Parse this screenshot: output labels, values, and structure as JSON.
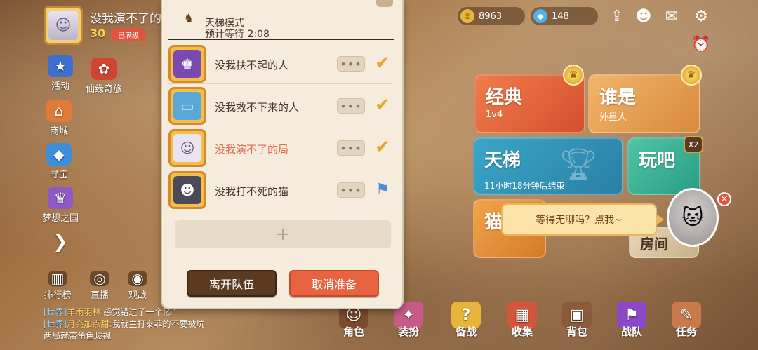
{
  "player": {
    "name": "没我演不了的局",
    "level": "30",
    "status": "已满级"
  },
  "left_nav": [
    {
      "label": "活动",
      "icon": "activity-icon"
    },
    {
      "label": "仙缘奇旅",
      "icon": "journey-icon"
    },
    {
      "label": "商城",
      "icon": "shop-icon"
    },
    {
      "label": "寻宝",
      "icon": "treasure-icon"
    },
    {
      "label": "梦想之国",
      "icon": "dreamland-icon"
    },
    {
      "label": "排行榜",
      "icon": "ranking-icon"
    },
    {
      "label": "直播",
      "icon": "live-icon"
    },
    {
      "label": "观战",
      "icon": "spectate-icon"
    }
  ],
  "resources": {
    "gold": "8963",
    "diamond": "148"
  },
  "modes": {
    "classic": {
      "title": "经典",
      "sub": "1v4"
    },
    "alien": {
      "title": "谁是",
      "sub": "外星人"
    },
    "ladder": {
      "title": "天梯",
      "sub": "11小时18分钟后结束"
    },
    "play": {
      "title": "玩吧",
      "badge": "X2"
    },
    "cat": {
      "title": "猫鼠"
    },
    "room": {
      "title": "房间"
    }
  },
  "chat_bubble": "等得无聊吗？点我~",
  "bottom_nav": [
    "角色",
    "装扮",
    "备战",
    "收集",
    "背包",
    "战队",
    "任务"
  ],
  "chat_log": [
    {
      "tag": "[世界]",
      "who": "羊雨羽林:",
      "msg": "感觉错过了一个亿？"
    },
    {
      "tag": "[世界]",
      "who": "月亮加点甜:",
      "msg": "我就主打泰菲的不要被坑两局就带角色歧视"
    }
  ],
  "team_panel": {
    "mode": "天梯模式",
    "wait": "预计等待 2:08",
    "members": [
      {
        "name": "没我扶不起的人",
        "status": "ready",
        "me": false
      },
      {
        "name": "没我救不下来的人",
        "status": "ready",
        "me": false
      },
      {
        "name": "没我演不了的局",
        "status": "ready",
        "me": true
      },
      {
        "name": "没我打不死的猫",
        "status": "leader",
        "me": false
      }
    ],
    "more_label": "•••",
    "add_label": "+",
    "leave_button": "离开队伍",
    "cancel_button": "取消准备"
  }
}
